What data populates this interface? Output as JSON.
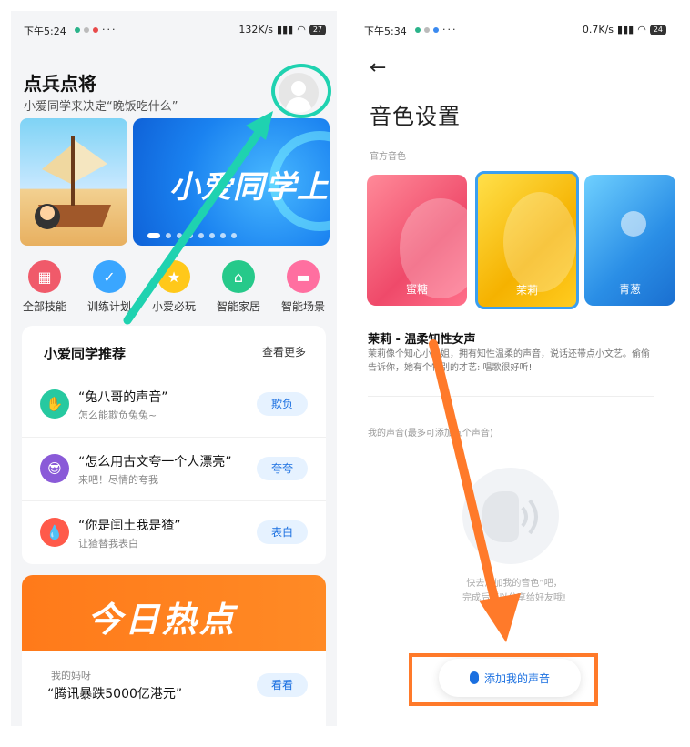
{
  "colors": {
    "annotation_teal": "#1fd2b0",
    "annotation_orange": "#ff7a2a",
    "accent_blue": "#1a6fe0",
    "hot_orange": "#ff7a1a"
  },
  "left": {
    "status": {
      "time": "下午5:24",
      "right": "132K/s",
      "battery": "27"
    },
    "title": "点兵点将",
    "subtitle": "小爱同学来决定“晚饭吃什么”",
    "banner_text": "小爱同学上",
    "quick": [
      {
        "label": "全部技能",
        "icon": "grid-icon",
        "color": "#f05a6a"
      },
      {
        "label": "训练计划",
        "icon": "clipboard-icon",
        "color": "#3aa6ff"
      },
      {
        "label": "小爱必玩",
        "icon": "star-icon",
        "color": "#ffc81a"
      },
      {
        "label": "智能家居",
        "icon": "home-icon",
        "color": "#26c98a"
      },
      {
        "label": "智能场景",
        "icon": "sofa-icon",
        "color": "#ff6fa0"
      }
    ],
    "recommend": {
      "title": "小爱同学推荐",
      "more": "查看更多",
      "items": [
        {
          "title": "“兔八哥的声音”",
          "sub": "怎么能欺负兔兔~",
          "button": "欺负",
          "icon_color": "#26c9a0"
        },
        {
          "title": "“怎么用古文夸一个人漂亮”",
          "sub": "来吧！尽情的夸我",
          "button": "夸夸",
          "icon_color": "#8a5ad8"
        },
        {
          "title": "“你是闰土我是猹”",
          "sub": "让猹替我表白",
          "button": "表白",
          "icon_color": "#ff5a4a"
        }
      ]
    },
    "hot_title": "今日热点",
    "news": {
      "kicker": "我的妈呀",
      "title": "“腾讯暴跌5000亿港元”",
      "button": "看看"
    }
  },
  "right": {
    "status": {
      "time": "下午5:34",
      "right": "0.7K/s",
      "battery": "24"
    },
    "back": "←",
    "title": "音色设置",
    "official_label": "官方音色",
    "voices": [
      {
        "label": "蜜糖"
      },
      {
        "label": "茉莉"
      },
      {
        "label": "青葱"
      }
    ],
    "selected_name": "茉莉 - 温柔知性女声",
    "selected_desc": "茉莉像个知心小姐姐，拥有知性温柔的声音，说话还带点小文艺。偷偷告诉你，她有个特别的才艺: 唱歌很好听!",
    "my_voice_label": "我的声音(最多可添加五个声音)",
    "empty_line1": "快去添加我的音色”吧，",
    "empty_line2": "完成后可以分享给好友哦!",
    "add_button": "添加我的声音"
  }
}
